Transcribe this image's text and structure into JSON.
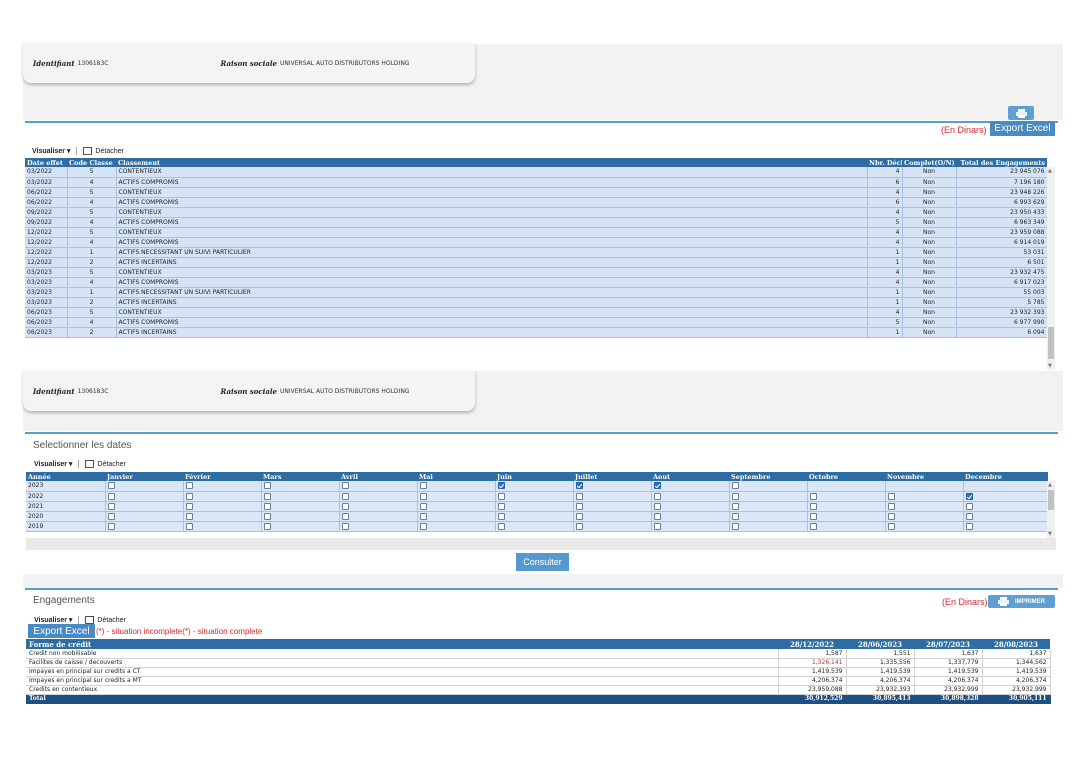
{
  "header": {
    "identifiant_label": "Identifiant",
    "identifiant_value": "1306183C",
    "raison_label": "Raison sociale",
    "raison_value": "UNIVERSAL AUTO DISTRIBUTORS HOLDING"
  },
  "top_section": {
    "unit_label": "(En Dinars)",
    "export_label": "Export Excel",
    "visualiser_label": "Visualiser ▾",
    "detacher_label": "Détacher",
    "columns": [
      "Date effet",
      "Code Classe",
      "Classement",
      "Nbr. Décl",
      "Complet(O/N)",
      "Total des Engagements"
    ],
    "rows": [
      [
        "03/2022",
        "5",
        "CONTENTIEUX",
        "4",
        "Non",
        "23 945 076"
      ],
      [
        "03/2022",
        "4",
        "ACTIFS COMPROMIS",
        "6",
        "Non",
        "7 196 180"
      ],
      [
        "06/2022",
        "5",
        "CONTENTIEUX",
        "4",
        "Non",
        "23 948 226"
      ],
      [
        "06/2022",
        "4",
        "ACTIFS COMPROMIS",
        "6",
        "Non",
        "6 993 629"
      ],
      [
        "09/2022",
        "5",
        "CONTENTIEUX",
        "4",
        "Non",
        "23 950 433"
      ],
      [
        "09/2022",
        "4",
        "ACTIFS COMPROMIS",
        "5",
        "Non",
        "6 963 349"
      ],
      [
        "12/2022",
        "5",
        "CONTENTIEUX",
        "4",
        "Non",
        "23 959 088"
      ],
      [
        "12/2022",
        "4",
        "ACTIFS COMPROMIS",
        "4",
        "Non",
        "6 914 019"
      ],
      [
        "12/2022",
        "1",
        "ACTIFS NECESSITANT UN SUIVI PARTICULIER",
        "1",
        "Non",
        "53 031"
      ],
      [
        "12/2022",
        "2",
        "ACTIFS INCERTAINS",
        "1",
        "Non",
        "6 501"
      ],
      [
        "03/2023",
        "5",
        "CONTENTIEUX",
        "4",
        "Non",
        "23 932 475"
      ],
      [
        "03/2023",
        "4",
        "ACTIFS COMPROMIS",
        "4",
        "Non",
        "6 917 023"
      ],
      [
        "03/2023",
        "1",
        "ACTIFS NECESSITANT UN SUIVI PARTICULIER",
        "1",
        "Non",
        "55 003"
      ],
      [
        "03/2023",
        "2",
        "ACTIFS INCERTAINS",
        "1",
        "Non",
        "5 785"
      ],
      [
        "06/2023",
        "5",
        "CONTENTIEUX",
        "4",
        "Non",
        "23 932 393"
      ],
      [
        "06/2023",
        "4",
        "ACTIFS COMPROMIS",
        "5",
        "Non",
        "6 977 990"
      ],
      [
        "06/2023",
        "2",
        "ACTIFS INCERTAINS",
        "1",
        "Non",
        "6 094"
      ]
    ]
  },
  "dates_section": {
    "title": "Selectionner les dates",
    "visualiser_label": "Visualiser ▾",
    "detacher_label": "Détacher",
    "columns": [
      "Année",
      "Janvier",
      "Février",
      "Mars",
      "Avril",
      "Mai",
      "Juin",
      "Juillet",
      "Aout",
      "Septembre",
      "Octobre",
      "Novembre",
      "Decembre"
    ],
    "rows": [
      {
        "year": "2023",
        "checks": [
          false,
          false,
          false,
          false,
          false,
          true,
          true,
          true,
          false,
          null,
          null,
          null
        ]
      },
      {
        "year": "2022",
        "checks": [
          false,
          false,
          false,
          false,
          false,
          false,
          false,
          false,
          false,
          false,
          false,
          true
        ]
      },
      {
        "year": "2021",
        "checks": [
          false,
          false,
          false,
          false,
          false,
          false,
          false,
          false,
          false,
          false,
          false,
          false
        ]
      },
      {
        "year": "2020",
        "checks": [
          false,
          false,
          false,
          false,
          false,
          false,
          false,
          false,
          false,
          false,
          false,
          false
        ]
      },
      {
        "year": "2019",
        "checks": [
          false,
          false,
          false,
          false,
          false,
          false,
          false,
          false,
          false,
          false,
          false,
          false
        ]
      }
    ],
    "consult_label": "Consulter"
  },
  "engagements_section": {
    "title": "Engagements",
    "unit_label": "(En Dinars)",
    "imprimer_label": "IMPRIMER",
    "visualiser_label": "Visualiser ▾",
    "detacher_label": "Détacher",
    "export_label": "Export Excel",
    "legend": "(*) - situation incomplete(*) - situation complete",
    "columns": [
      "Forme de crédit",
      "28/12/2022",
      "28/06/2023",
      "28/07/2023",
      "28/08/2023"
    ],
    "rows": [
      {
        "label": "Credit non mobilisable",
        "values": [
          "1,587",
          "1,551",
          "1,637",
          "1,637"
        ],
        "red": [
          false,
          false,
          false,
          false
        ]
      },
      {
        "label": "Facilites de caisse / decouverts",
        "values": [
          "1,326,141",
          "1,335,556",
          "1,337,779",
          "1,344,562"
        ],
        "red": [
          true,
          false,
          false,
          false
        ]
      },
      {
        "label": "Impayes en principal sur credits a CT",
        "values": [
          "1,419,539",
          "1,419,539",
          "1,419,539",
          "1,419,539"
        ],
        "red": [
          false,
          false,
          false,
          false
        ]
      },
      {
        "label": "Impayes en principal sur credits a MT",
        "values": [
          "4,206,374",
          "4,206,374",
          "4,206,374",
          "4,206,374"
        ],
        "red": [
          false,
          false,
          false,
          false
        ]
      },
      {
        "label": "Credits en contentieux",
        "values": [
          "23,959,088",
          "23,932,393",
          "23,932,999",
          "23,932,999"
        ],
        "red": [
          false,
          false,
          false,
          false
        ]
      }
    ],
    "total": {
      "label": "Total",
      "values": [
        "30,912,529",
        "30,895,413",
        "30,898,328",
        "30,905,111"
      ]
    }
  },
  "colors": {
    "accent": "#2e6da4",
    "row_bg": "#d6e3f5",
    "warning": "#d12a2a"
  },
  "icons": [
    "printer-icon",
    "detach-icon",
    "checkbox-icon"
  ]
}
